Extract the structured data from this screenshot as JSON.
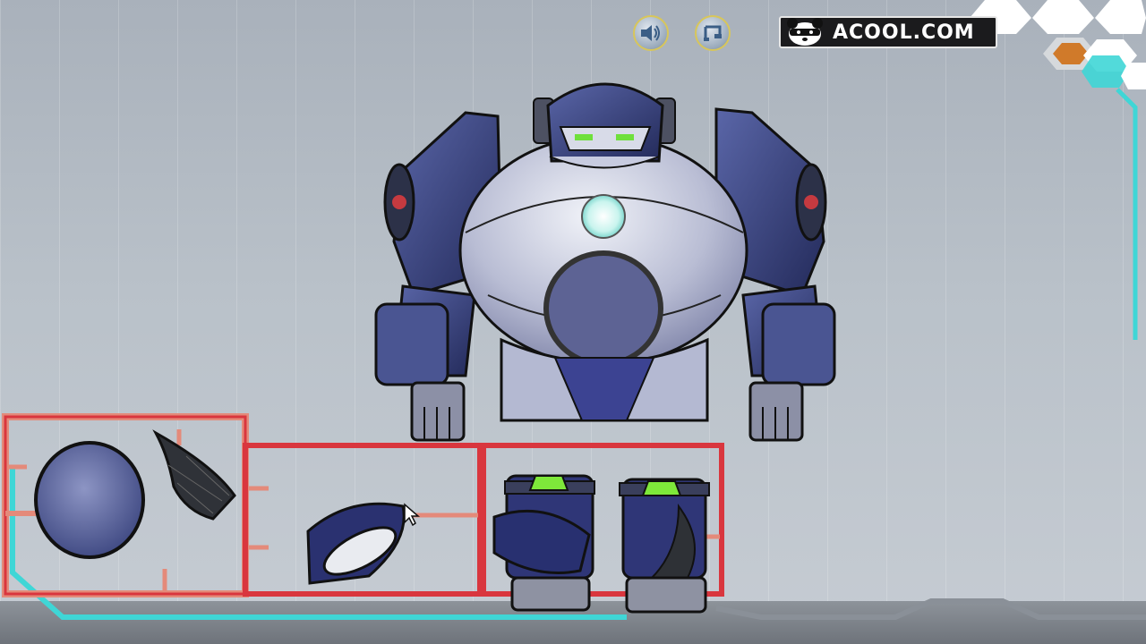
{
  "game": {
    "logo_text": "ACOOL.COM",
    "accent_color": "#40d8d8",
    "frame_color": "#d9363e",
    "frame_edge_color": "#e48a7a"
  },
  "toolbar": {
    "sound_icon": "speaker-icon",
    "music_icon": "music-note-icon"
  },
  "parts_tray": {
    "panels": [
      {
        "name": "panel-1",
        "parts": [
          "round-shield-plate",
          "mesh-fin-plate"
        ]
      },
      {
        "name": "panel-2",
        "parts": [
          "curved-arm-plate"
        ]
      },
      {
        "name": "panel-3",
        "parts": [
          "left-leg-armor",
          "right-leg-armor"
        ]
      }
    ]
  }
}
